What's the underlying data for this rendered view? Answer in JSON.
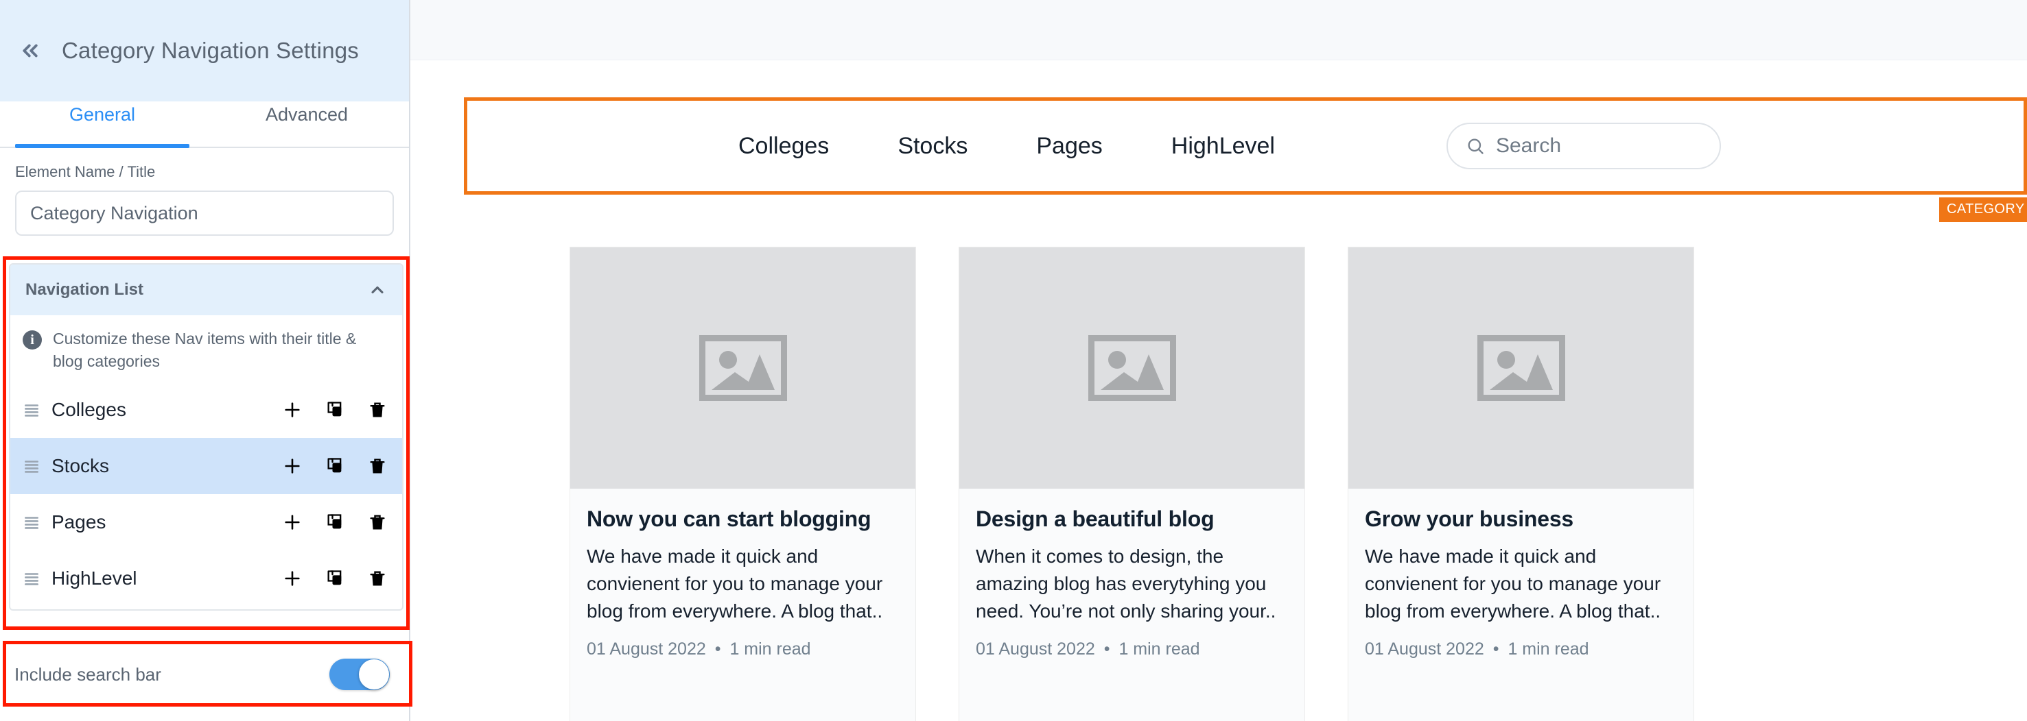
{
  "panel": {
    "collapse_icon": "chevrons-left-icon",
    "title": "Category Navigation Settings",
    "tabs": [
      {
        "label": "General",
        "active": true
      },
      {
        "label": "Advanced",
        "active": false
      }
    ],
    "element_name_field": {
      "label": "Element Name / Title",
      "value": "Category Navigation",
      "placeholder": "Category Navigation"
    },
    "navigation_list": {
      "header": "Navigation List",
      "collapse_icon": "chevron-up-icon",
      "hint_icon": "info-icon",
      "hint": "Customize these Nav items with their title & blog categories",
      "row_actions": {
        "add": "plus-icon",
        "duplicate": "copy-icon",
        "delete": "trash-icon"
      },
      "items": [
        {
          "label": "Colleges",
          "selected": false
        },
        {
          "label": "Stocks",
          "selected": true
        },
        {
          "label": "Pages",
          "selected": false
        },
        {
          "label": "HighLevel",
          "selected": false
        }
      ]
    },
    "include_search_bar": {
      "label": "Include search bar",
      "enabled": true
    },
    "highlight_color": "#ff1a00"
  },
  "preview": {
    "selection_color": "#f07616",
    "badge": "CATEGORY NAVIGATION",
    "nav_links": [
      "Colleges",
      "Stocks",
      "Pages",
      "HighLevel"
    ],
    "search": {
      "icon": "search-icon",
      "placeholder": "Search"
    },
    "cards": [
      {
        "image_icon": "image-placeholder-icon",
        "title": "Now you can start blogging",
        "description": "We have made it quick and convienent for you to manage your blog from everywhere. A blog that..",
        "date": "01 August 2022",
        "separator": "•",
        "read_time": "1 min read"
      },
      {
        "image_icon": "image-placeholder-icon",
        "title": "Design a beautiful blog",
        "description": "When it comes to design, the amazing blog has everytyhing you need. You’re not only sharing your..",
        "date": "01 August 2022",
        "separator": "•",
        "read_time": "1 min read"
      },
      {
        "image_icon": "image-placeholder-icon",
        "title": "Grow your business",
        "description": "We have made it quick and convienent for you to manage your blog from everywhere. A blog that..",
        "date": "01 August 2022",
        "separator": "•",
        "read_time": "1 min read"
      }
    ]
  }
}
